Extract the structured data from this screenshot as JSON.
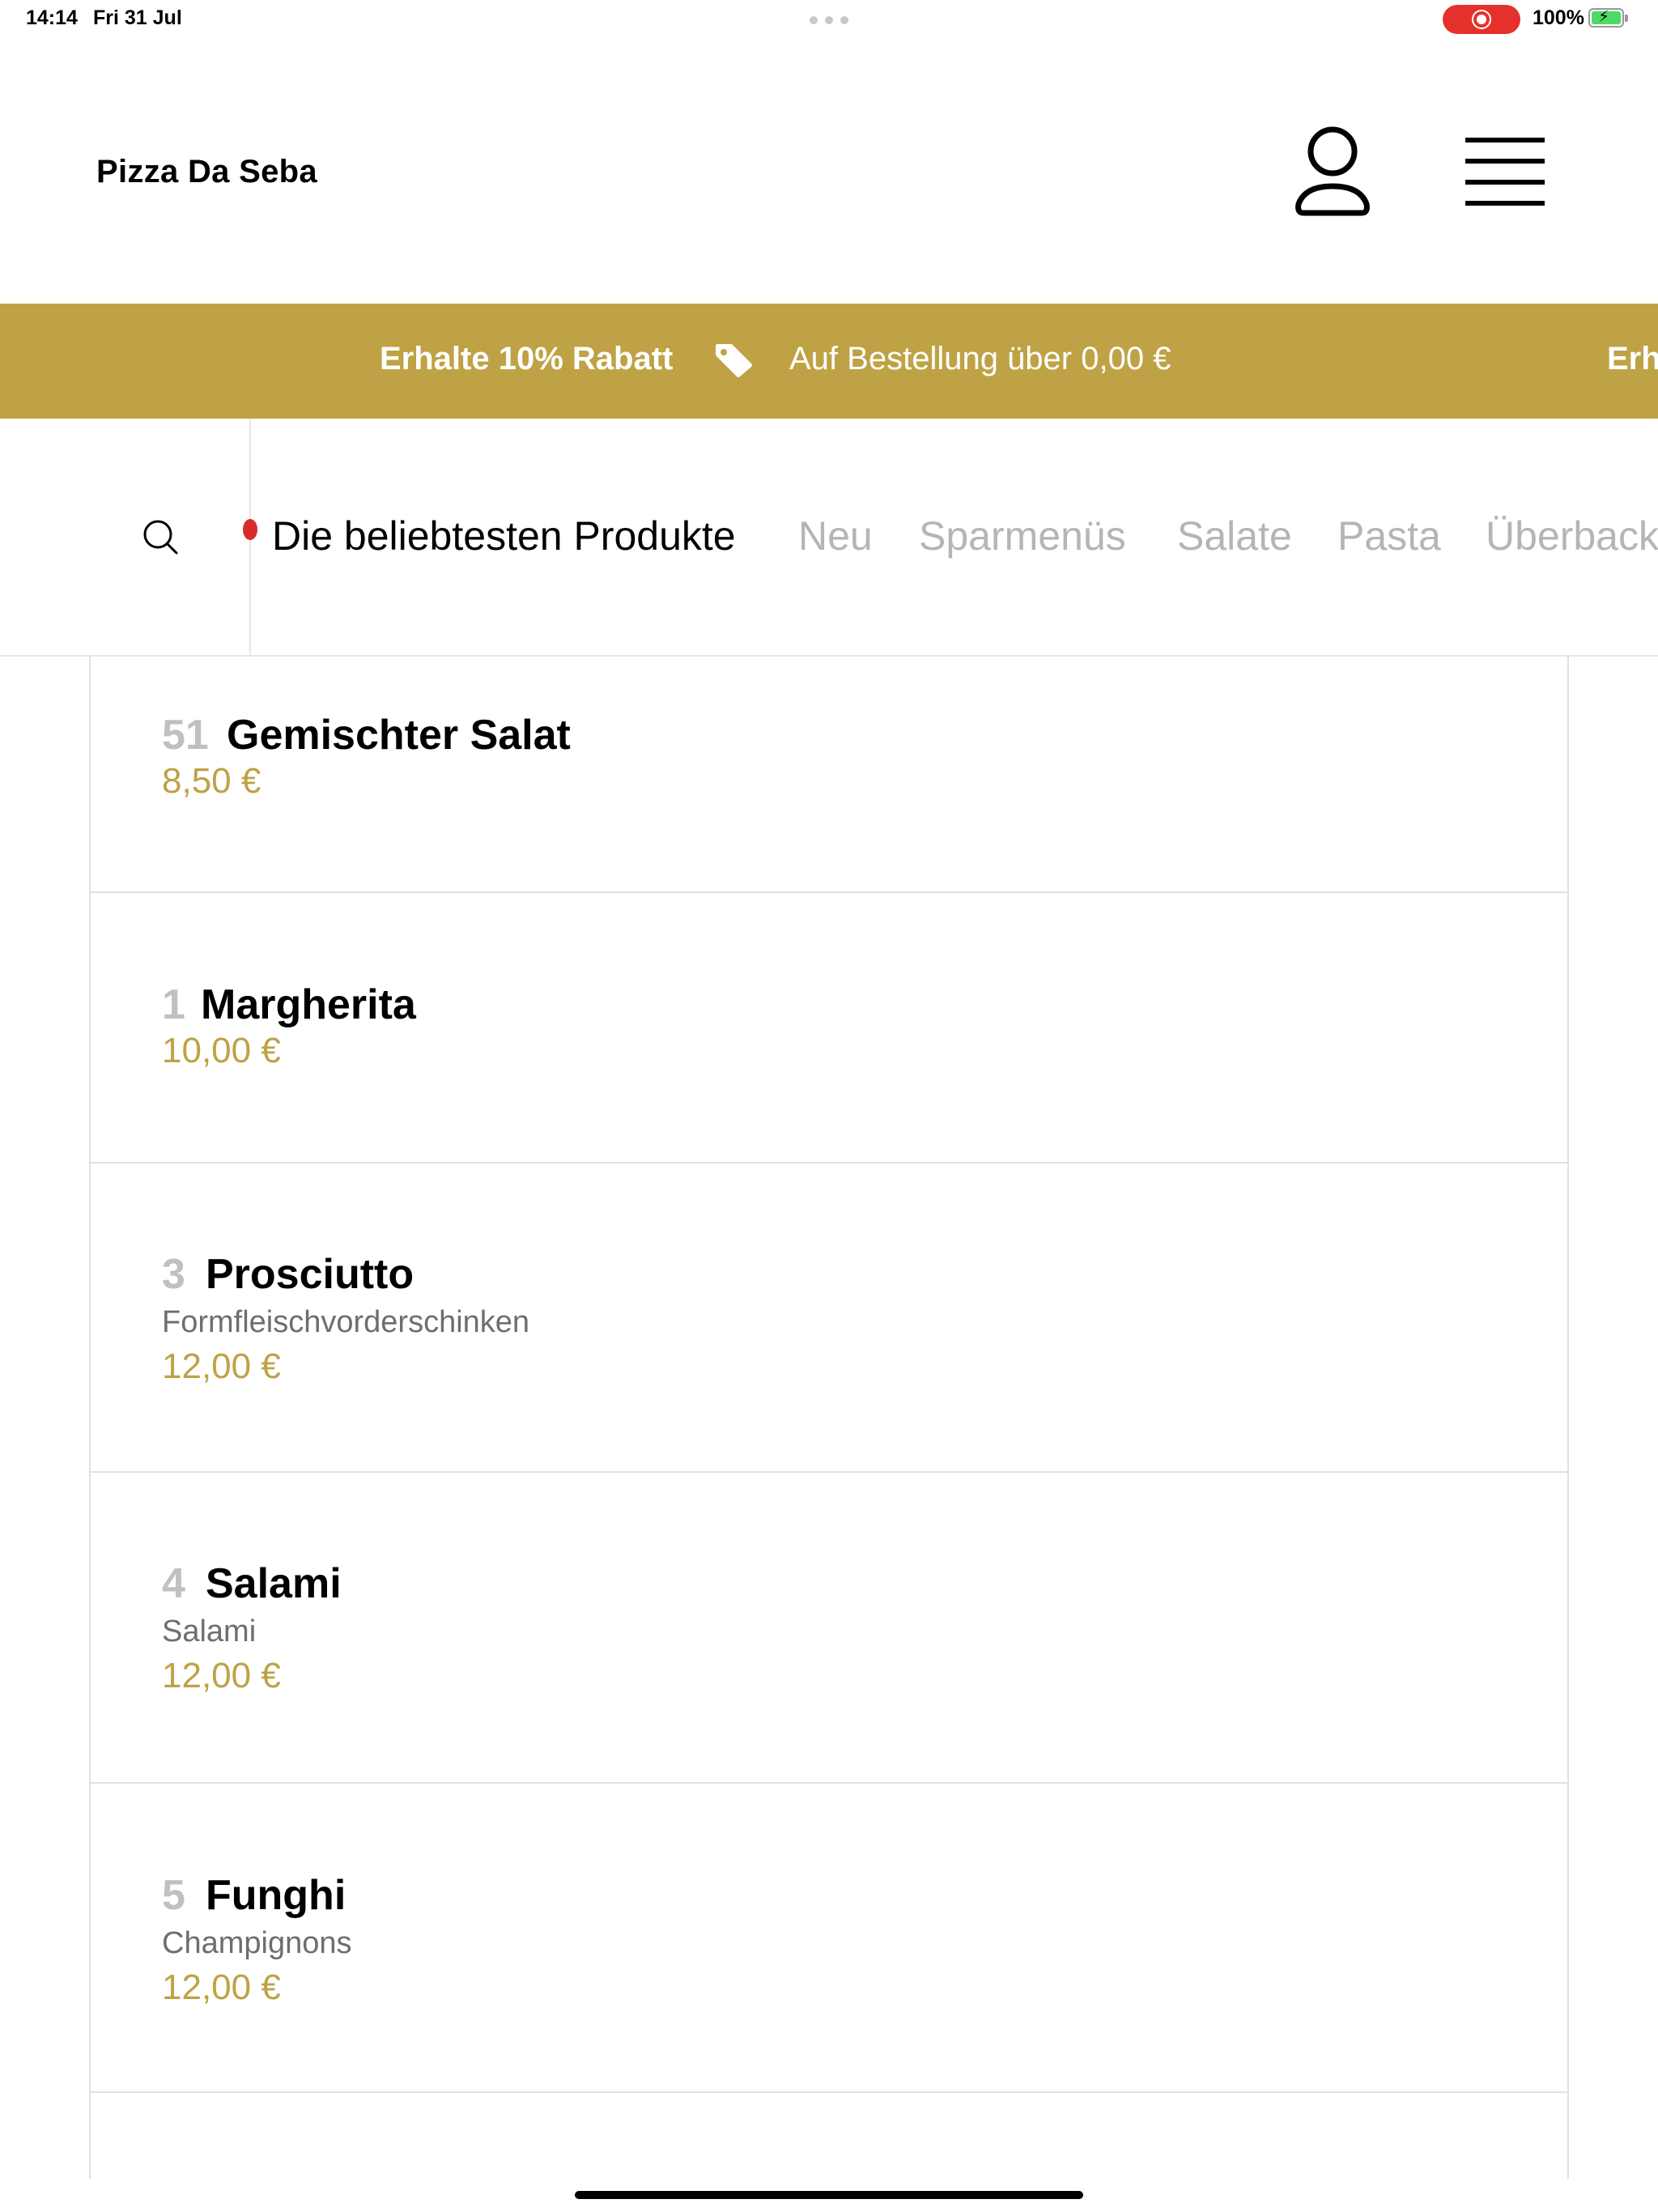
{
  "status_bar": {
    "time": "14:14",
    "date": "Fri 31 Jul",
    "battery": "100%"
  },
  "header": {
    "brand": "Pizza Da Seba",
    "icons": {
      "account": "user-icon",
      "menu": "hamburger-menu-icon"
    }
  },
  "promo": {
    "title": "Erhalte 10% Rabatt",
    "text": "Auf Bestellung über 0,00 €",
    "repeat_fragment": "Erh",
    "color": "#bfa245"
  },
  "categories": {
    "active": "Die beliebtesten Produkte",
    "items": [
      "Neu",
      "Sparmenüs",
      "Salate",
      "Pasta",
      "Überback"
    ]
  },
  "products": [
    {
      "number": "51",
      "name": "Gemischter Salat",
      "description": "",
      "price": "8,50 €"
    },
    {
      "number": "1",
      "name": "Margherita",
      "description": "",
      "price": "10,00 €"
    },
    {
      "number": "3",
      "name": "Prosciutto",
      "description": "Formfleischvorderschinken",
      "price": "12,00 €"
    },
    {
      "number": "4",
      "name": "Salami",
      "description": "Salami",
      "price": "12,00 €"
    },
    {
      "number": "5",
      "name": "Funghi",
      "description": "Champignons",
      "price": "12,00 €"
    }
  ],
  "colors": {
    "accent": "#bfa245",
    "muted": "#b5b5b5",
    "record": "#e5312c"
  }
}
